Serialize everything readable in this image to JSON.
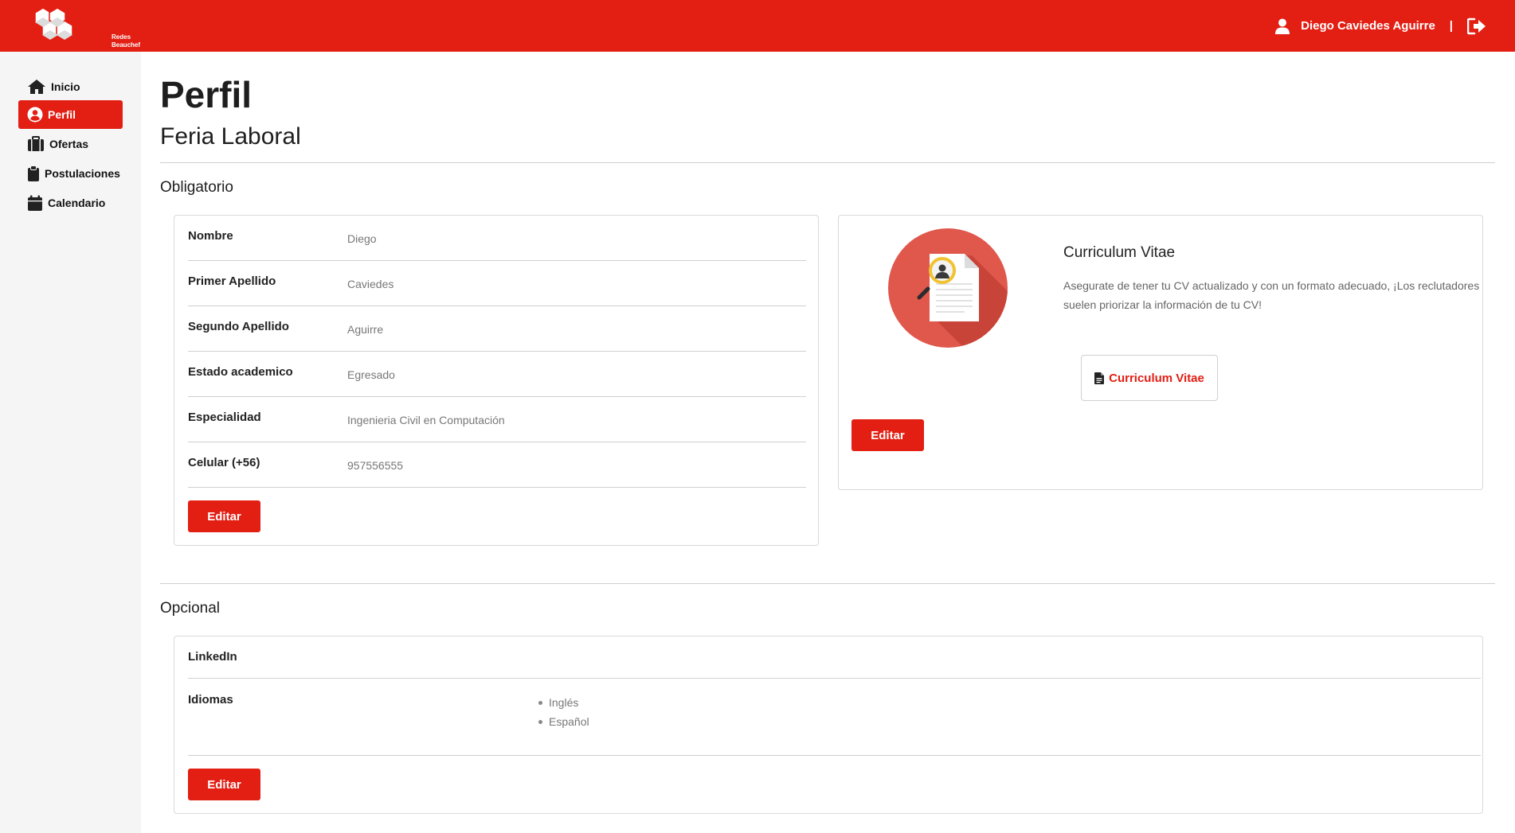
{
  "header": {
    "logo_line1": "Redes",
    "logo_line2": "Beauchef",
    "user_name": "Diego Caviedes Aguirre",
    "separator": "|",
    "brand_color": "#e31e13"
  },
  "sidebar": {
    "items": [
      {
        "label": "Inicio",
        "icon": "home-icon",
        "active": false
      },
      {
        "label": "Perfil",
        "icon": "user-circle-icon",
        "active": true
      },
      {
        "label": "Ofertas",
        "icon": "briefcase-icon",
        "active": false
      },
      {
        "label": "Postulaciones",
        "icon": "clipboard-icon",
        "active": false
      },
      {
        "label": "Calendario",
        "icon": "calendar-icon",
        "active": false
      }
    ]
  },
  "main": {
    "title": "Perfil",
    "subtitle": "Feria Laboral",
    "required_section": {
      "title": "Obligatorio",
      "fields": [
        {
          "label": "Nombre",
          "value": "Diego"
        },
        {
          "label": "Primer Apellido",
          "value": "Caviedes"
        },
        {
          "label": "Segundo Apellido",
          "value": "Aguirre"
        },
        {
          "label": "Estado academico",
          "value": "Egresado"
        },
        {
          "label": "Especialidad",
          "value": "Ingenieria Civil en Computación"
        },
        {
          "label": "Celular (+56)",
          "value": "957556555"
        }
      ],
      "edit_label": "Editar"
    },
    "cv_card": {
      "title": "Curriculum Vitae",
      "description": "Asegurate de tener tu CV actualizado y con un formato adecuado, ¡Los reclutadores suelen priorizar la información de tu CV!",
      "cv_button_label": "Curriculum Vitae",
      "edit_label": "Editar"
    },
    "optional_section": {
      "title": "Opcional",
      "linkedin_label": "LinkedIn",
      "languages_label": "Idiomas",
      "languages": [
        "Inglés",
        "Español"
      ],
      "edit_label": "Editar"
    }
  }
}
